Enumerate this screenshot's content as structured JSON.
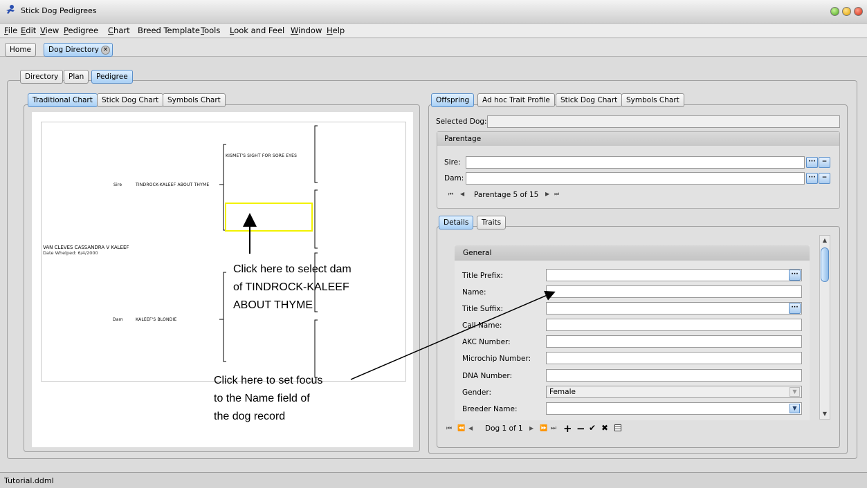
{
  "window": {
    "title": "Stick Dog Pedigrees"
  },
  "menu": [
    {
      "label": "File",
      "accel": "F",
      "rest": "ile"
    },
    {
      "label": "Edit",
      "accel": "E",
      "rest": "dit"
    },
    {
      "label": "View",
      "accel": "V",
      "rest": "iew"
    },
    {
      "label": "Pedigree",
      "accel": "P",
      "rest": "edigree"
    },
    {
      "label": "Chart",
      "accel": "C",
      "rest": "hart"
    },
    {
      "label": "Breed Template",
      "accel": "",
      "rest": "Breed Template"
    },
    {
      "label": "Tools",
      "accel": "T",
      "rest": "ools"
    },
    {
      "label": "Look and Feel",
      "accel": "L",
      "rest": "ook and Feel"
    },
    {
      "label": "Window",
      "accel": "W",
      "rest": "indow"
    },
    {
      "label": "Help",
      "accel": "H",
      "rest": "elp"
    }
  ],
  "doc_tabs": {
    "home": "Home",
    "dog_directory": "Dog Directory"
  },
  "view_tabs": {
    "directory": "Directory",
    "plan": "Plan",
    "pedigree": "Pedigree"
  },
  "chart_tabs": {
    "traditional": "Traditional Chart",
    "stick": "Stick Dog Chart",
    "symbols": "Symbols Chart"
  },
  "pedigree": {
    "dog_name": "VAN CLEVES CASSANDRA V KALEEF",
    "whelped": "Date Whelped: 6/4/2000",
    "sire_label": "Sire",
    "sire_name": "TINDROCK-KALEEF ABOUT THYME",
    "dam_label": "Dam",
    "dam_name": "KALEEF'S BLONDIE",
    "grand_sire": "KISMET'S SIGHT FOR SORE EYES"
  },
  "annotations": {
    "dam_lines": [
      "Click here to select dam",
      "of TINDROCK-KALEEF",
      "ABOUT THYME"
    ],
    "focus_lines": [
      "Click here to set focus",
      "to the Name field of",
      "the dog record"
    ]
  },
  "right_tabs": {
    "offspring": "Offspring",
    "adhoc": "Ad hoc Trait Profile",
    "stick": "Stick Dog Chart",
    "symbols": "Symbols Chart"
  },
  "selected_dog": {
    "label": "Selected Dog:",
    "value": ""
  },
  "parentage": {
    "title": "Parentage",
    "sire_label": "Sire:",
    "dam_label": "Dam:",
    "nav_text": "Parentage 5 of 15"
  },
  "detail_tabs": {
    "details": "Details",
    "traits": "Traits"
  },
  "general": {
    "title": "General",
    "fields": [
      {
        "label": "Title Prefix:",
        "value": "",
        "kind": "dots"
      },
      {
        "label": "Name:",
        "value": "",
        "kind": "text"
      },
      {
        "label": "Title Suffix:",
        "value": "",
        "kind": "dots"
      },
      {
        "label": "Call Name:",
        "value": "",
        "kind": "text"
      },
      {
        "label": "AKC Number:",
        "value": "",
        "kind": "text"
      },
      {
        "label": "Microchip Number:",
        "value": "",
        "kind": "text"
      },
      {
        "label": "DNA Number:",
        "value": "",
        "kind": "text"
      },
      {
        "label": "Gender:",
        "value": "Female",
        "kind": "combo-disabled"
      },
      {
        "label": "Breeder Name:",
        "value": "",
        "kind": "combo"
      }
    ],
    "nav_text": "Dog 1 of 1"
  },
  "status": {
    "file": "Tutorial.ddml"
  }
}
